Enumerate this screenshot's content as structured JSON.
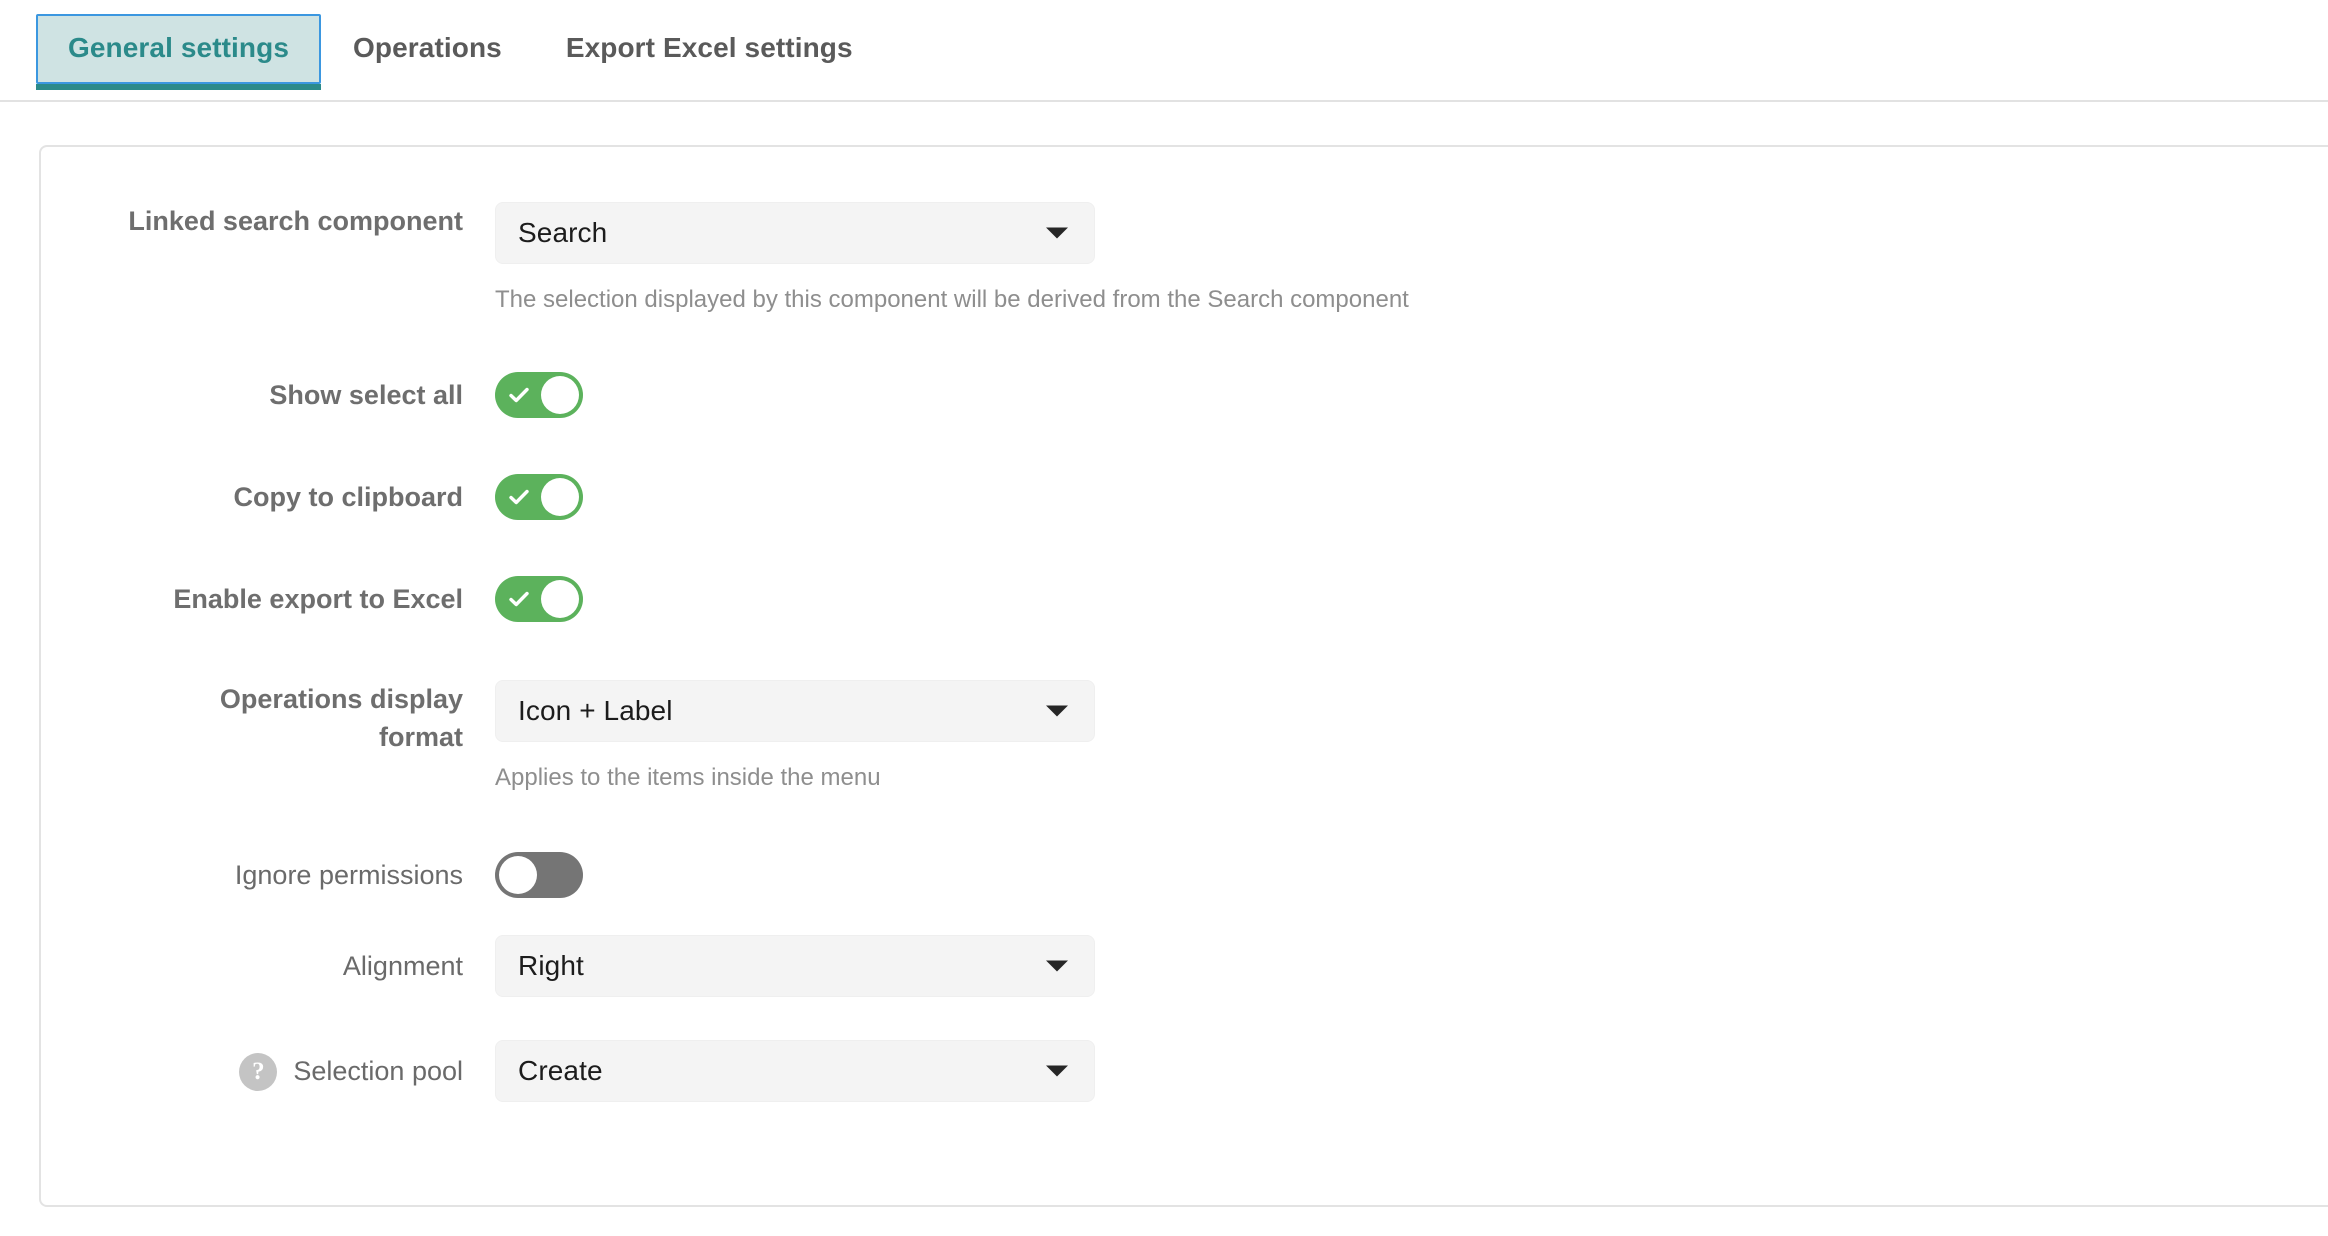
{
  "tabs": [
    {
      "label": "General settings",
      "active": true
    },
    {
      "label": "Operations",
      "active": false
    },
    {
      "label": "Export Excel settings",
      "active": false
    }
  ],
  "colors": {
    "active_tab_text": "#2b8a8a",
    "active_tab_bg": "#cfe3e3",
    "focus_ring": "#3b97e0",
    "toggle_on": "#5cb25c",
    "toggle_off": "#757575",
    "label_text": "#6e6e6e",
    "hint_text": "#8e8e8e",
    "select_bg": "#f4f4f4",
    "panel_border": "#e3e3e3"
  },
  "form": {
    "linked_search_component": {
      "label": "Linked search component",
      "value": "Search",
      "hint": "The selection displayed by this component will be derived from the Search component",
      "caret_icon": "chevron-down-icon"
    },
    "show_select_all": {
      "label": "Show select all",
      "state": "on",
      "icon": "check-icon"
    },
    "copy_to_clipboard": {
      "label": "Copy to clipboard",
      "state": "on",
      "icon": "check-icon"
    },
    "enable_export_to_excel": {
      "label": "Enable export to Excel",
      "state": "on",
      "icon": "check-icon"
    },
    "operations_display_format": {
      "label": "Operations display format",
      "value": "Icon + Label",
      "hint": "Applies to the items inside the menu",
      "caret_icon": "chevron-down-icon"
    },
    "ignore_permissions": {
      "label": "Ignore permissions",
      "state": "off"
    },
    "alignment": {
      "label": "Alignment",
      "value": "Right",
      "caret_icon": "chevron-down-icon"
    },
    "selection_pool": {
      "label": "Selection pool",
      "value": "Create",
      "help_icon": "question-mark-icon",
      "help_glyph": "?",
      "caret_icon": "chevron-down-icon"
    }
  }
}
